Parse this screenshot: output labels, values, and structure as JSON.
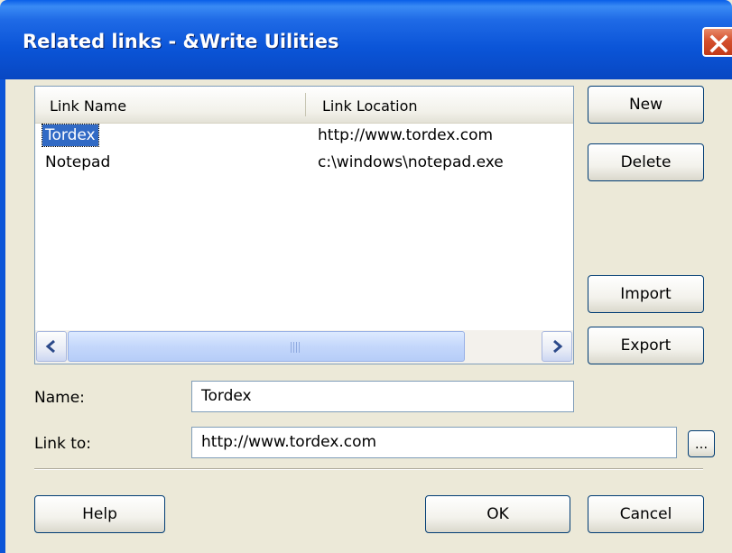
{
  "window": {
    "title": "Related links - &Write Uilities"
  },
  "icons": {
    "close": "close-icon",
    "scroll_left": "chevron-left-icon",
    "scroll_right": "chevron-right-icon",
    "grip": "scroll-grip-icon"
  },
  "colors": {
    "titlebar": "#0b55d8",
    "selection": "#316ac5",
    "close_button": "#d4502e",
    "dialog_bg": "#ece9d8"
  },
  "list": {
    "columns": [
      "Link Name",
      "Link Location"
    ],
    "rows": [
      {
        "name": "Tordex",
        "location": "http://www.tordex.com",
        "selected": true
      },
      {
        "name": "Notepad",
        "location": "c:\\windows\\notepad.exe",
        "selected": false
      }
    ]
  },
  "buttons": {
    "new": "New",
    "delete": "Delete",
    "import": "Import",
    "export": "Export",
    "browse": "...",
    "help": "Help",
    "ok": "OK",
    "cancel": "Cancel"
  },
  "form": {
    "name_label": "Name:",
    "name_value": "Tordex",
    "link_label": "Link to:",
    "link_value": "http://www.tordex.com"
  }
}
